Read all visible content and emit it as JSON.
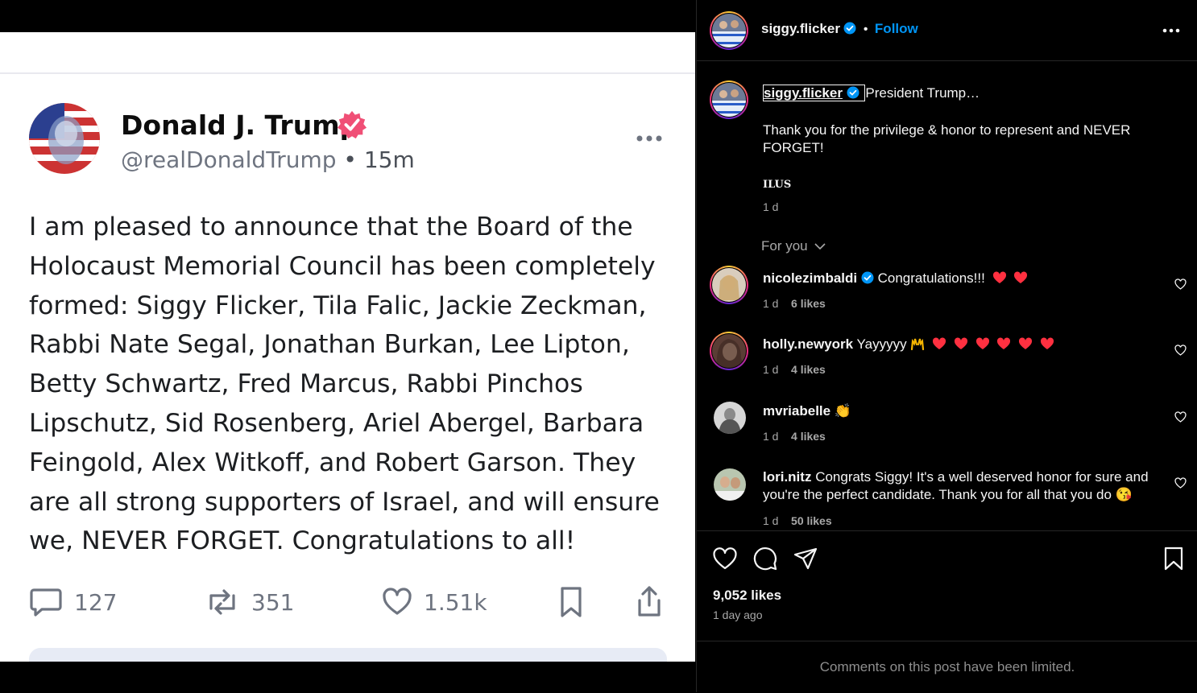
{
  "embedded_post": {
    "author_name": "Donald J. Trump",
    "handle": "@realDonaldTrump",
    "separator": "•",
    "time": "15m",
    "body_lines": [
      "I am pleased to announce that the Board of the",
      "Holocaust Memorial Council has been completely",
      "formed: Siggy Flicker, Tila Falic, Jackie Zeckman,",
      "Rabbi Nate Segal, Jonathan Burkan, Lee Lipton,",
      "Betty Schwartz, Fred Marcus, Rabbi Pinchos",
      "Lipschutz, Sid Rosenberg, Ariel Abergel, Barbara",
      "Feingold, Alex Witkoff, and Robert Garson. They",
      "are all strong supporters of Israel, and will ensure",
      "we, NEVER FORGET. Congratulations to all!"
    ],
    "replies": "127",
    "retruths": "351",
    "likes": "1.51k"
  },
  "header": {
    "username": "siggy.flicker",
    "separator": "•",
    "follow_label": "Follow"
  },
  "caption": {
    "username": "siggy.flicker",
    "title": "President Trump…",
    "body": "Thank you for the privilege & honor to represent and NEVER FORGET!",
    "tag": "ILUS",
    "time": "1 d"
  },
  "filter_label": "For you",
  "comments": [
    {
      "username": "nicolezimbaldi",
      "text": "Congratulations!!!",
      "time": "1 d",
      "likes": "6 likes"
    },
    {
      "username": "holly.newyork",
      "text": "Yayyyyy",
      "time": "1 d",
      "likes": "4 likes"
    },
    {
      "username": "mvriabelle",
      "text": "👏",
      "time": "1 d",
      "likes": "4 likes"
    },
    {
      "username": "lori.nitz",
      "text": "Congrats Siggy! It's a well deserved honor for sure and you're the perfect candidate. Thank you for all that you do 😘",
      "time": "1 d",
      "likes": "50 likes"
    }
  ],
  "actions": {
    "likes_count": "9,052 likes",
    "posted": "1 day ago"
  },
  "footer_note": "Comments on this post have been limited.",
  "colors": {
    "accent": "#0095f6",
    "verified": "#0095f6",
    "truth_verified": "#f04f76",
    "heart": "#ff3040"
  }
}
